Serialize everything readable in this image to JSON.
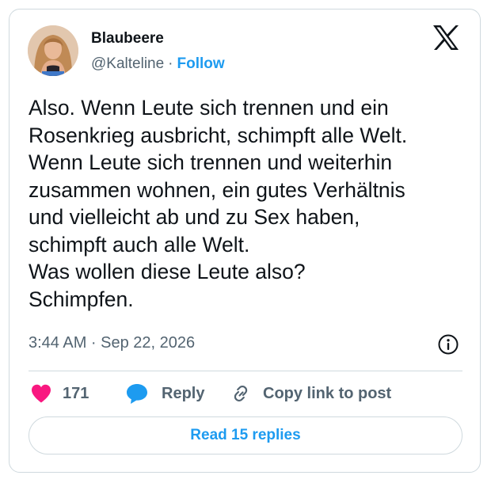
{
  "author": {
    "display_name": "Blaubeere",
    "handle": "@Kalteline",
    "separator": "·",
    "follow_label": "Follow"
  },
  "tweet": {
    "lines": [
      "Also. Wenn Leute sich trennen und ein",
      "Rosenkrieg ausbricht, schimpft alle Welt.",
      "Wenn Leute sich trennen und weiterhin",
      "zusammen wohnen, ein gutes Verhältnis",
      "und vielleicht ab und zu Sex haben,",
      "schimpft auch alle Welt.",
      "Was wollen diese Leute also?",
      "Schimpfen."
    ],
    "timestamp": "3:44 AM · Sep 22, 2026"
  },
  "actions": {
    "like_count": "171",
    "reply_label": "Reply",
    "copy_label": "Copy link to post",
    "read_replies_label": "Read 15 replies"
  },
  "icons": {
    "like": "heart-icon",
    "reply": "speech-bubble-icon",
    "copy": "link-icon",
    "info": "info-icon",
    "brand": "x-logo-icon"
  },
  "colors": {
    "accent": "#1d9bf0",
    "like": "#f91880",
    "text": "#0f1419",
    "secondary": "#536471",
    "border": "#cfd9de"
  }
}
